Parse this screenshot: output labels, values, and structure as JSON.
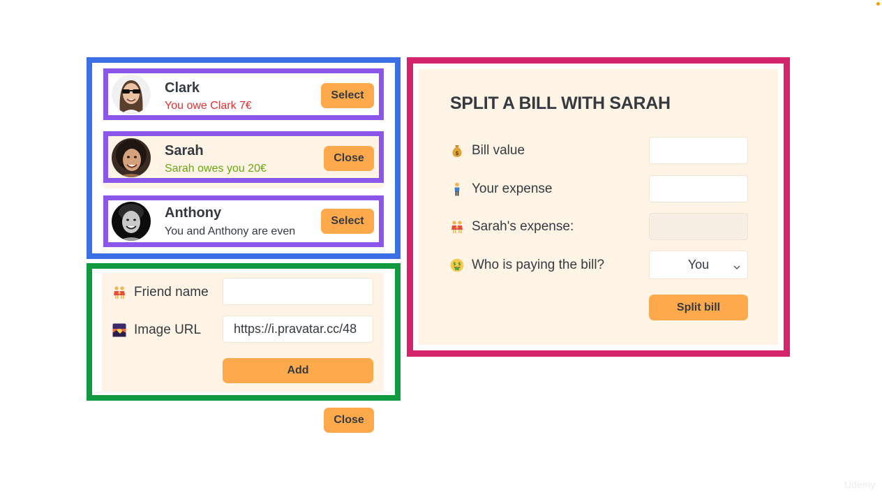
{
  "friends": [
    {
      "name": "Clark",
      "status": "You owe Clark 7€",
      "status_color": "#e03131",
      "button": "Select"
    },
    {
      "name": "Sarah",
      "status": "Sarah owes you 20€",
      "status_color": "#66a80f",
      "button": "Close"
    },
    {
      "name": "Anthony",
      "status": "You and Anthony are even",
      "status_color": "#343a40",
      "button": "Select"
    }
  ],
  "add_friend_form": {
    "name_label": "Friend name",
    "name_value": "",
    "image_label": "Image URL",
    "image_value": "https://i.pravatar.cc/48",
    "add_button": "Add"
  },
  "close_form_button": "Close",
  "split_form": {
    "title": "SPLIT A BILL WITH SARAH",
    "bill_label": "Bill value",
    "bill_value": "",
    "your_expense_label": "Your expense",
    "your_expense_value": "",
    "friend_expense_label": "Sarah's expense:",
    "friend_expense_value": "",
    "payer_label": "Who is paying the bill?",
    "payer_value": "You",
    "submit_button": "Split bill"
  },
  "watermark": "Udemy",
  "colors": {
    "accent": "#ffa94d",
    "cream": "#fff4e6",
    "outline_blue": "#3b6fe6",
    "outline_green": "#0f9a3f",
    "outline_pink": "#d6246c",
    "outline_purple": "#8a57ea",
    "negative": "#e03131",
    "positive": "#66a80f"
  },
  "icons": {
    "bill": "money-bag-icon",
    "your_expense": "person-standing-icon",
    "friend_expense": "people-holding-hands-icon",
    "payer": "money-mouth-face-icon",
    "friend_name": "people-holding-hands-icon",
    "image_url": "sunset-image-icon",
    "select_arrow": "chevron-down-icon"
  }
}
